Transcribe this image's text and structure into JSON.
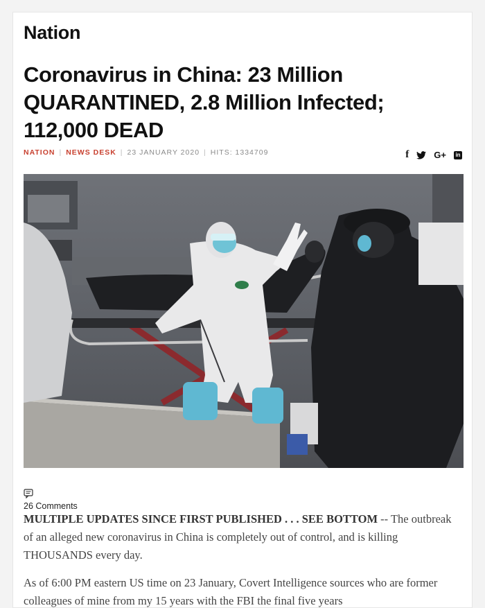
{
  "section": "Nation",
  "article": {
    "title": "Coronavirus in China: 23 Million QUARANTINED, 2.8 Million Infected; 112,000 DEAD",
    "meta": {
      "category": "NATION",
      "author": "NEWS DESK",
      "date": "23 JANUARY 2020",
      "hits": "HITS: 1334709"
    },
    "share_icons": [
      "facebook-icon",
      "twitter-icon",
      "google-plus-icon",
      "linkedin-icon"
    ],
    "share_labels": {
      "facebook": "f",
      "google_plus": "G+",
      "linkedin": "in"
    },
    "comments": "26 Comments",
    "paragraph1_lead": "MULTIPLE UPDATES SINCE FIRST PUBLISHED . . . SEE BOTTOM",
    "paragraph1_rest": " -- The outbreak of an alleged new coronavirus in China is completely out of control, and is killing THOUSANDS every day.",
    "paragraph2": "As of 6:00 PM eastern US time on 23 January, Covert Intelligence sources who are former colleagues of mine from my 15 years with the FBI the final five years"
  },
  "colors": {
    "accent": "#c8402f",
    "text": "#111111",
    "muted": "#8a8a8a"
  }
}
